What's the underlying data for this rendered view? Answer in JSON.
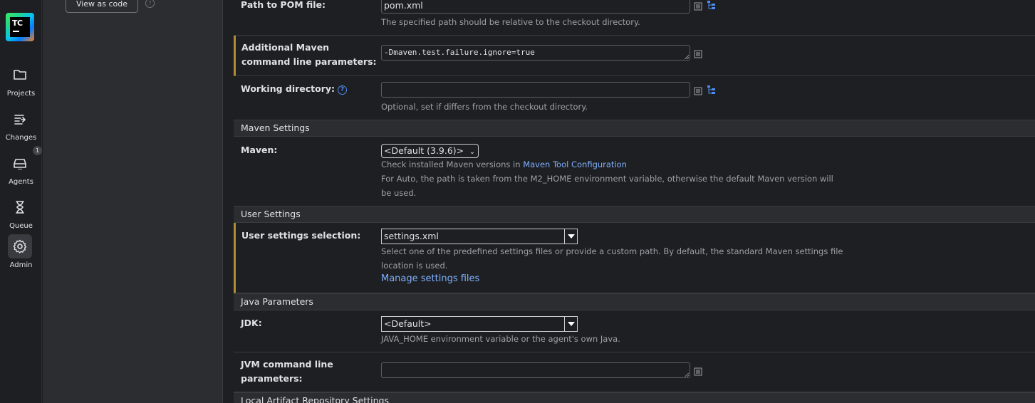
{
  "brand": {
    "logo_text": "TC"
  },
  "nav": {
    "items": [
      {
        "label": "Projects",
        "icon": "folder-icon"
      },
      {
        "label": "Changes",
        "icon": "changes-icon"
      },
      {
        "label": "Agents",
        "icon": "agents-icon",
        "badge": "1"
      },
      {
        "label": "Queue",
        "icon": "hourglass-icon"
      },
      {
        "label": "Admin",
        "icon": "gear-icon",
        "active": true
      }
    ]
  },
  "sidebar": {
    "view_as_code": "View as code",
    "help": "?"
  },
  "form": {
    "pom": {
      "label": "Path to POM file:",
      "value": "pom.xml",
      "hint": "The specified path should be relative to the checkout directory."
    },
    "additional_params": {
      "label_line1": "Additional Maven",
      "label_line2": "command line parameters:",
      "value": "-Dmaven.test.failure.ignore=true"
    },
    "working_dir": {
      "label": "Working directory:",
      "value": "",
      "hint": "Optional, set if differs from the checkout directory."
    },
    "maven_settings": {
      "section_title": "Maven Settings",
      "label": "Maven:",
      "selected": "<Default (3.9.6)>",
      "hint_prefix": "Check installed Maven versions in ",
      "hint_link": "Maven Tool Configuration",
      "hint_line2": "For Auto, the path is taken from the M2_HOME environment variable, otherwise the default Maven version will",
      "hint_line3": "be used."
    },
    "user_settings": {
      "section_title": "User Settings",
      "label": "User settings selection:",
      "selected": "settings.xml",
      "hint_line1": "Select one of the predefined settings files or provide a custom path. By default, the standard Maven settings file",
      "hint_line2": "location is used.",
      "manage_link": "Manage settings files"
    },
    "java": {
      "section_title": "Java Parameters",
      "jdk_label": "JDK:",
      "jdk_selected": "<Default>",
      "jdk_hint": "JAVA_HOME environment variable or the agent's own Java.",
      "jvm_label_line1": "JVM command line",
      "jvm_label_line2": "parameters:",
      "jvm_value": ""
    },
    "local_repo": {
      "section_title": "Local Artifact Repository Settings"
    }
  },
  "colors": {
    "background": "#1e1f22",
    "panel": "#2b2d30",
    "modified_marker": "#b28c32",
    "link": "#7fb0ff"
  }
}
